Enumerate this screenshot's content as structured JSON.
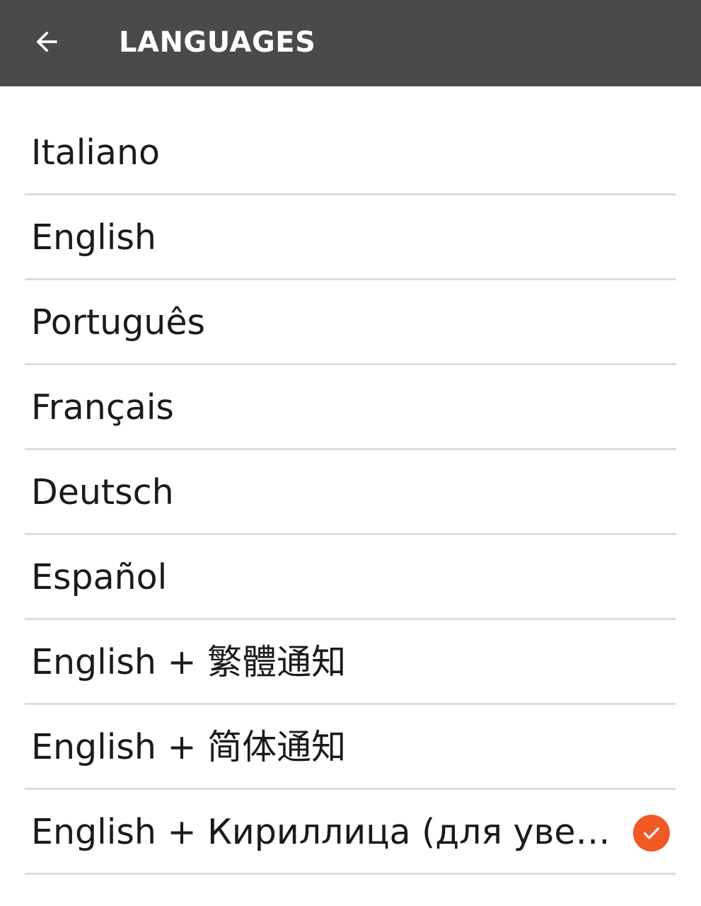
{
  "app_bar": {
    "title": "LANGUAGES",
    "back_icon": "arrow-back-icon",
    "background": "#4a4a4a"
  },
  "languages": [
    {
      "label": "Italiano",
      "selected": false
    },
    {
      "label": "English",
      "selected": false
    },
    {
      "label": "Português",
      "selected": false
    },
    {
      "label": "Français",
      "selected": false
    },
    {
      "label": "Deutsch",
      "selected": false
    },
    {
      "label": "Español",
      "selected": false
    },
    {
      "label": "English + 繁體通知",
      "selected": false
    },
    {
      "label": "English + 简体通知",
      "selected": false
    },
    {
      "label": "English + Кириллица (для уведом…",
      "selected": true
    }
  ],
  "accent_color": "#f15a24",
  "selected_icon": "checkmark-circle-icon"
}
